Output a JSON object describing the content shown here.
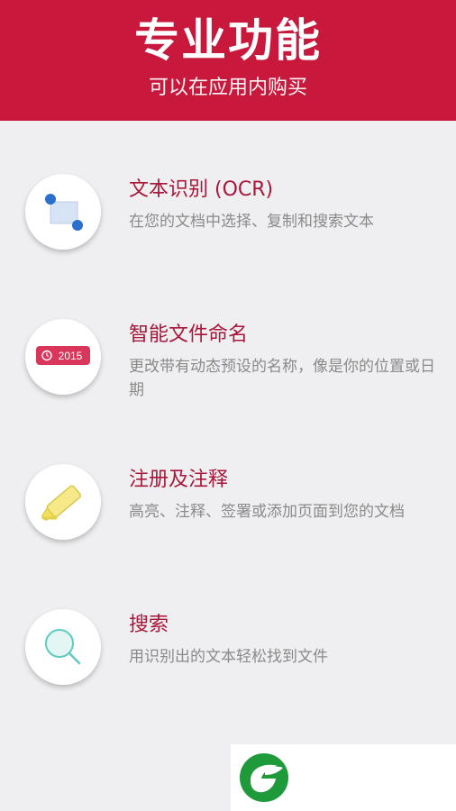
{
  "header": {
    "title": "专业功能",
    "subtitle": "可以在应用内购买"
  },
  "features": [
    {
      "icon": "ocr-selection-icon",
      "title": "文本识别 (OCR)",
      "description": "在您的文档中选择、复制和搜索文本"
    },
    {
      "icon": "date-tag-icon",
      "icon_text": "2015",
      "title": "智能文件命名",
      "description": "更改带有动态预设的名称，像是你的位置或日期"
    },
    {
      "icon": "highlighter-icon",
      "title": "注册及注释",
      "description": "高亮、注释、签署或添加页面到您的文档"
    },
    {
      "icon": "search-icon",
      "title": "搜索",
      "description": "用识别出的文本轻松找到文件"
    }
  ],
  "colors": {
    "header_bg": "#c8193c",
    "title_color": "#a8173a",
    "page_bg": "#efeff1",
    "logo_green": "#1e9a3a"
  }
}
